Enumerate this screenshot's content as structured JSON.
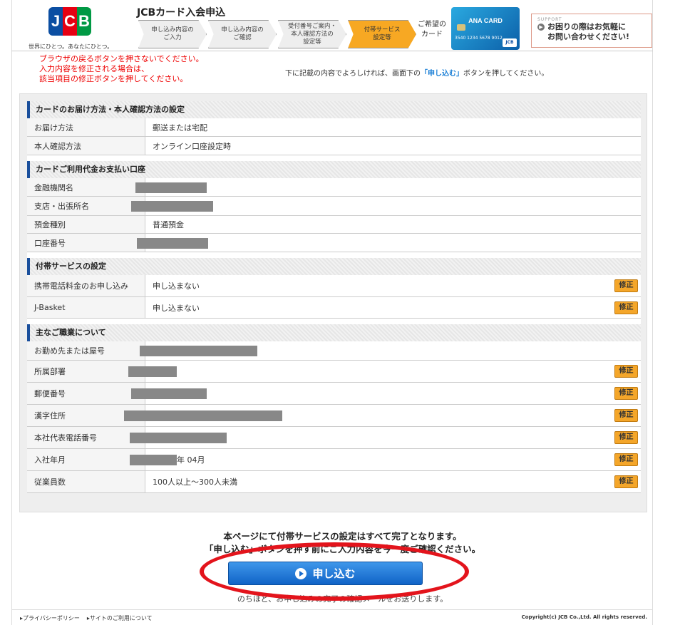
{
  "header": {
    "logo_text": "JCB",
    "slogan": "世界にひとつ。あなたにひとつ。",
    "title": "JCBカード入会申込",
    "steps": [
      {
        "label": "申し込み内容の\nご入力",
        "active": false
      },
      {
        "label": "申し込み内容の\nご確認",
        "active": false
      },
      {
        "label": "受付番号ご案内・\n本人確認方法の\n設定等",
        "active": false
      },
      {
        "label": "付帯サービス\n設定等",
        "active": true
      }
    ],
    "wish_card_label": "ご希望の\nカード",
    "card_brand": "ANA CARD",
    "card_number": "3540 1234 5678 9012",
    "support_label": "SUPPORT",
    "support_text": "お困りの際はお気軽に\nお問い合わせください!"
  },
  "notice": {
    "warning_lines": [
      "ブラウザの戻るボタンを押さないでください。",
      "入力内容を修正される場合は、",
      "該当項目の修正ボタンを押してください。"
    ],
    "instruction_pre": "下に記載の内容でよろしければ、画面下の",
    "instruction_hl": "「申し込む」",
    "instruction_post": "ボタンを押してください。"
  },
  "fix_label": "修正",
  "sections": [
    {
      "title": "カードのお届け方法・本人確認方法の設定",
      "rows": [
        {
          "label": "お届け方法",
          "value": "郵送または宅配",
          "fix": false
        },
        {
          "label": "本人確認方法",
          "value": "オンライン口座設定時",
          "fix": false
        }
      ]
    },
    {
      "title": "カードご利用代金お支払い口座",
      "rows": [
        {
          "label": "金融機関名",
          "value": "",
          "fix": false,
          "redacted": true
        },
        {
          "label": "支店・出張所名",
          "value": "",
          "fix": false,
          "redacted": true
        },
        {
          "label": "預金種別",
          "value": "普通預金",
          "fix": false
        },
        {
          "label": "口座番号",
          "value": "",
          "fix": false,
          "redacted": true
        }
      ]
    },
    {
      "title": "付帯サービスの設定",
      "rows": [
        {
          "label": "携帯電話料金のお申し込み",
          "value": "申し込まない",
          "fix": true
        },
        {
          "label": "J-Basket",
          "value": "申し込まない",
          "fix": true
        }
      ]
    },
    {
      "title": "主なご職業について",
      "rows": [
        {
          "label": "お勤め先または屋号",
          "value": "",
          "fix": false,
          "redacted": true
        },
        {
          "label": "所属部署",
          "value": "",
          "fix": true,
          "redacted": true
        },
        {
          "label": "郵便番号",
          "value": "",
          "fix": true,
          "redacted": true
        },
        {
          "label": "漢字住所",
          "value": "",
          "fix": true,
          "redacted": true
        },
        {
          "label": "本社代表電話番号",
          "value": "",
          "fix": true,
          "redacted": true
        },
        {
          "label": "入社年月",
          "value": "年 04月",
          "fix": true,
          "redacted": true
        },
        {
          "label": "従業員数",
          "value": "100人以上～300人未満",
          "fix": true
        }
      ]
    }
  ],
  "completion": {
    "line1": "本ページにて付帯サービスの設定はすべて完了となります。",
    "line2": "「申し込む」ボタンを押す前にご入力内容を今一度ご確認ください。",
    "apply_label": "申し込む",
    "after_text": "のちほど、お申し込みの完了の確認メールをお送りします。"
  },
  "footer": {
    "privacy": "▸プライバシーポリシー",
    "terms": "▸サイトのご利用について",
    "copyright": "Copyright(c) JCB Co.,Ltd. All rights reserved."
  }
}
